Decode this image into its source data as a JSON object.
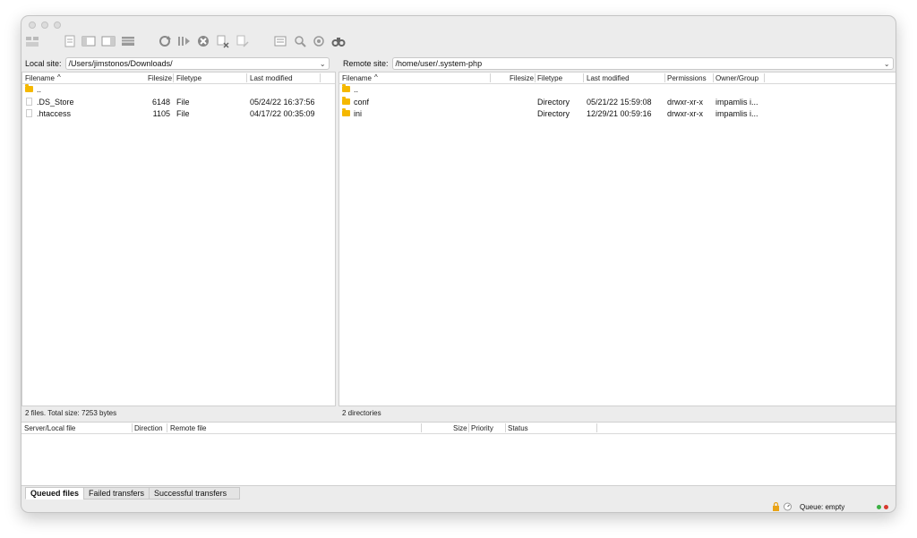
{
  "local": {
    "label": "Local site:",
    "path": "/Users/jimstonos/Downloads/",
    "columns": [
      "Filename",
      "Filesize",
      "Filetype",
      "Last modified"
    ],
    "files": [
      {
        "name": "..",
        "size": "",
        "type": "",
        "modified": "",
        "icon": "folder"
      },
      {
        "name": ".DS_Store",
        "size": "6148",
        "type": "File",
        "modified": "05/24/22 16:37:56",
        "icon": "file"
      },
      {
        "name": ".htaccess",
        "size": "1105",
        "type": "File",
        "modified": "04/17/22 00:35:09",
        "icon": "file"
      }
    ],
    "status": "2 files. Total size: 7253 bytes"
  },
  "remote": {
    "label": "Remote site:",
    "path": "/home/user/.system-php",
    "columns": [
      "Filename",
      "Filesize",
      "Filetype",
      "Last modified",
      "Permissions",
      "Owner/Group"
    ],
    "files": [
      {
        "name": "..",
        "size": "",
        "type": "",
        "modified": "",
        "perms": "",
        "owner": "",
        "icon": "folder"
      },
      {
        "name": "conf",
        "size": "",
        "type": "Directory",
        "modified": "05/21/22 15:59:08",
        "perms": "drwxr-xr-x",
        "owner": "impamlis i...",
        "icon": "folder"
      },
      {
        "name": "ini",
        "size": "",
        "type": "Directory",
        "modified": "12/29/21 00:59:16",
        "perms": "drwxr-xr-x",
        "owner": "impamlis i...",
        "icon": "folder"
      }
    ],
    "status": "2 directories"
  },
  "queue": {
    "columns": [
      "Server/Local file",
      "Direction",
      "Remote file",
      "Size",
      "Priority",
      "Status"
    ]
  },
  "tabs": [
    "Queued files",
    "Failed transfers",
    "Successful transfers"
  ],
  "statusbar": {
    "queue": "Queue: empty"
  },
  "colors": {
    "folder": "#f5b800",
    "led_green": "#3cb043",
    "led_red": "#d83a2f"
  }
}
